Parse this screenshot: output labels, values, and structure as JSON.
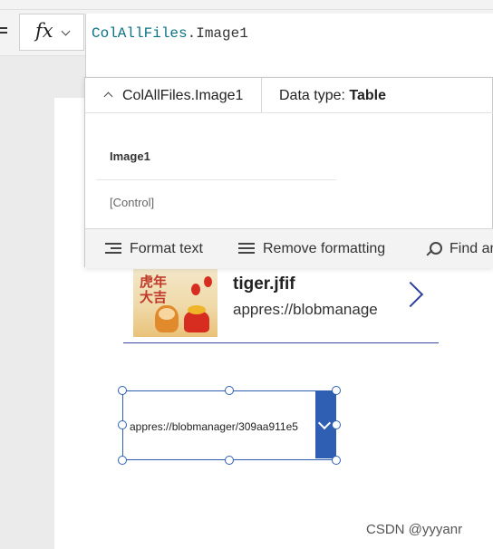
{
  "formula_bar": {
    "fx_label": "fx",
    "formula_collection": "ColAllFiles",
    "formula_property": ".Image1"
  },
  "intellisense": {
    "expression": "ColAllFiles.Image1",
    "data_type_label": "Data type: ",
    "data_type_value": "Table",
    "column_name": "Image1",
    "column_type": "[Control]"
  },
  "toolbar": {
    "format_text": "Format text",
    "remove_formatting": "Remove formatting",
    "find": "Find an"
  },
  "gallery": {
    "item_title": "tiger.jfif",
    "item_subtitle": "appres://blobmanage",
    "thumbnail_text": "虎年大吉"
  },
  "dropdown": {
    "value": "appres://blobmanager/309aa911e5"
  },
  "watermark": "CSDN @yyyanr",
  "colors": {
    "selection_blue": "#2f5fb3",
    "chevron_blue": "#2c3e9e",
    "formula_identifier": "#0b7285"
  }
}
